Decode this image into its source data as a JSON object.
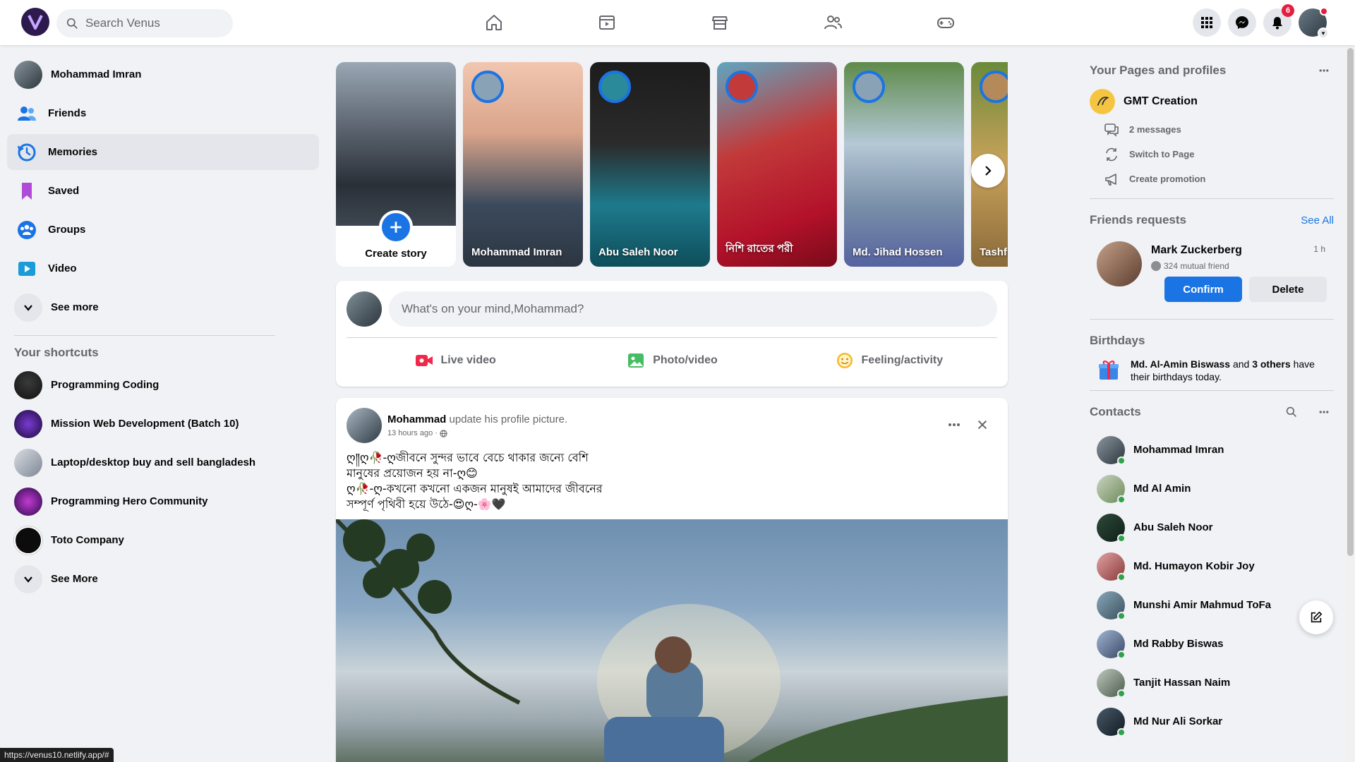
{
  "app": {
    "name": "Venus",
    "accent": "#1b74e4"
  },
  "topbar": {
    "search_placeholder": "Search Venus",
    "nav": [
      "home-icon",
      "video-icon",
      "marketplace-icon",
      "friends-icon",
      "gaming-icon"
    ],
    "notifications_count": "6"
  },
  "leftbar": {
    "items": [
      {
        "label": "Mohammad Imran",
        "icon": "avatar"
      },
      {
        "label": "Friends",
        "icon": "friends-icon"
      },
      {
        "label": "Memories",
        "icon": "memories-icon"
      },
      {
        "label": "Saved",
        "icon": "bookmark-icon"
      },
      {
        "label": "Groups",
        "icon": "groups-icon"
      },
      {
        "label": "Video",
        "icon": "video-play-icon"
      },
      {
        "label": "See more",
        "icon": "chevron-down-icon"
      }
    ],
    "shortcuts_title": "Your shortcuts",
    "shortcuts": [
      {
        "label": "Programming Coding"
      },
      {
        "label": "Mission Web Development (Batch 10)"
      },
      {
        "label": "Laptop/desktop buy and sell bangladesh"
      },
      {
        "label": "Programming Hero Community"
      },
      {
        "label": "Toto Company"
      },
      {
        "label": "See More"
      }
    ]
  },
  "stories": {
    "create_label": "Create story",
    "items": [
      {
        "name": "Mohammad Imran"
      },
      {
        "name": "Abu Saleh Noor"
      },
      {
        "name": "নিশি রাতের পরী"
      },
      {
        "name": "Md. Jihad Hossen"
      },
      {
        "name": "Tashfi"
      }
    ]
  },
  "composer": {
    "placeholder": "What's on your mind,Mohammad?",
    "actions": [
      {
        "label": "Live video"
      },
      {
        "label": "Photo/video"
      },
      {
        "label": "Feeling/activity"
      }
    ]
  },
  "post": {
    "author": "Mohammad",
    "action": "update his profile picture.",
    "time": "13 hours ago ·",
    "text": "ღ༎ღ🥀-ღজীবনে সুন্দর ভাবে বেচে থাকার জন্যে বেশি\nমানুষের প্রয়োজন হয় না-ღ😊\nღ🥀-ღ-কখনো কখনো একজন মানুষই আমাদের জীবনের\nসম্পূর্ণ পৃথিবী হয়ে উঠে-😍ღ-🌸🖤"
  },
  "rightbar": {
    "pages_title": "Your Pages and profiles",
    "page_name": "GMT Creation",
    "page_actions": [
      "2 messages",
      "Switch to Page",
      "Create promotion"
    ],
    "requests_title": "Friends requests",
    "see_all": "See All",
    "request": {
      "name": "Mark Zuckerberg",
      "time": "1 h",
      "mutual": "324 mutual friend",
      "confirm": "Confirm",
      "delete": "Delete"
    },
    "birthdays_title": "Birthdays",
    "birthday": {
      "name": "Md. Al-Amin Biswass",
      "and": "and",
      "others": "3 others",
      "rest": "have their birthdays today."
    },
    "contacts_title": "Contacts",
    "contacts": [
      "Mohammad Imran",
      "Md Al Amin",
      "Abu Saleh Noor",
      "Md. Humayon Kobir Joy",
      "Munshi Amir Mahmud ToFa",
      "Md Rabby Biswas",
      "Tanjit Hassan Naim",
      "Md Nur Ali Sorkar"
    ]
  },
  "status_url": "https://venus10.netlify.app/#"
}
